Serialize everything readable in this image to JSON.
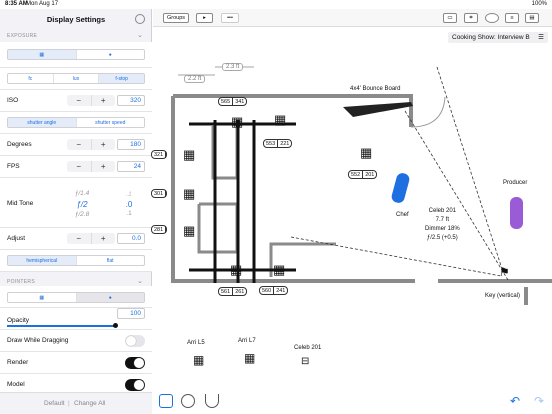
{
  "status": {
    "time": "8:35 AM",
    "date": "Mon Aug 17",
    "battery": "100%"
  },
  "panel": {
    "title": "Display Settings",
    "exposure_header": "EXPOSURE",
    "units": [
      "fc",
      "lux",
      "f-stop"
    ],
    "iso": {
      "label": "ISO",
      "value": "320"
    },
    "shutter_modes": [
      "shutter angle",
      "shutter speed"
    ],
    "degrees": {
      "label": "Degrees",
      "value": "180"
    },
    "fps": {
      "label": "FPS",
      "value": "24"
    },
    "mid_tone": {
      "label": "Mid Tone",
      "stops": [
        "ƒ/1.4",
        "ƒ/2",
        "ƒ/2.8"
      ],
      "fracs": [
        ".0",
        ".1",
        ".2"
      ]
    },
    "adjust": {
      "label": "Adjust",
      "value": "0.0"
    },
    "meter_modes": [
      "hemispherical",
      "flat"
    ],
    "pointers_header": "POINTERS",
    "opacity": {
      "label": "Opacity",
      "value": "100"
    },
    "draw_while_dragging": "Draw While Dragging",
    "render": "Render",
    "model": "Model",
    "default": "Default",
    "change_all": "Change All"
  },
  "toolbar": {
    "groups": "Groups",
    "more": "•••"
  },
  "scene": {
    "name": "Cooking Show: Interview B"
  },
  "plot": {
    "dim1": "2.3 ft",
    "dim2": "2.2 ft",
    "bounce": "4x4' Bounce Board",
    "chef": "Chef",
    "producer": "Producer",
    "key_label": "Key (vertical)",
    "celeb_info": [
      "Celeb 201",
      "7.7 ft",
      "Dimmer 18%",
      "ƒ/2.5 (+0.5)"
    ],
    "channels": [
      [
        "565",
        "341"
      ],
      [
        "553",
        "221"
      ],
      [
        "552",
        "201"
      ],
      [
        "321"
      ],
      [
        "301"
      ],
      [
        "281"
      ],
      [
        "561",
        "261"
      ],
      [
        "560",
        "241"
      ]
    ],
    "palette": [
      "Arri L5",
      "Arri L7",
      "Celeb 201"
    ]
  },
  "colors": {
    "accent": "#1e6fe0",
    "chef": "#1e6fe0",
    "producer": "#9a5cd6",
    "wall": "#8a8a8a"
  }
}
